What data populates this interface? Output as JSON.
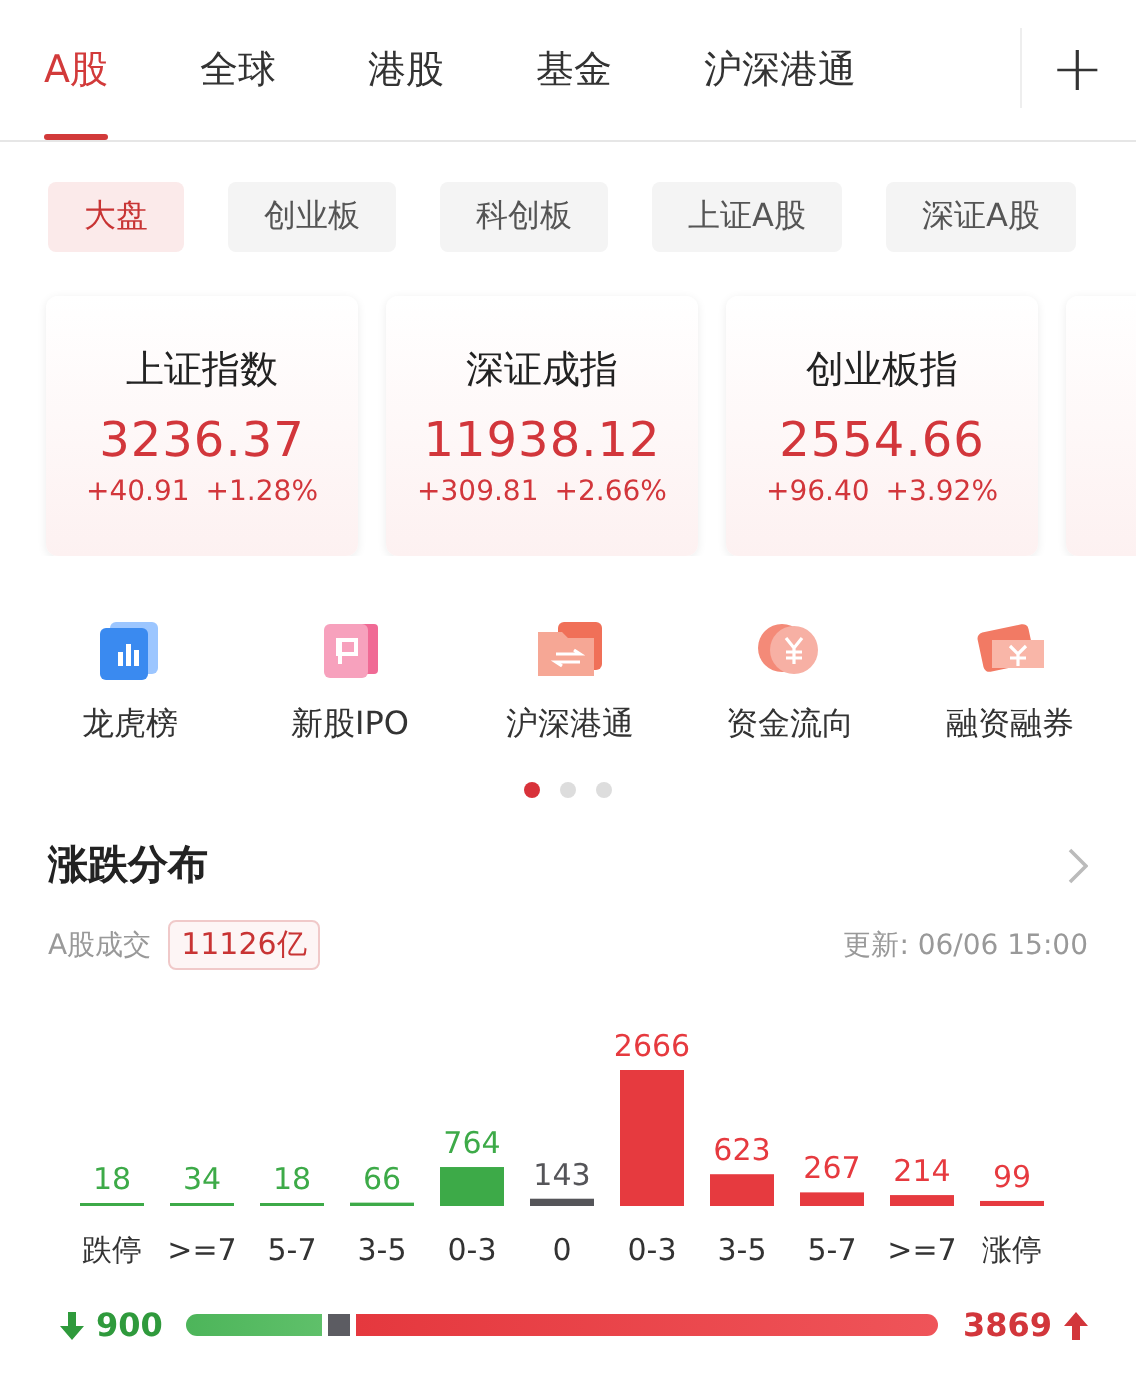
{
  "tabs": [
    {
      "label": "A股",
      "selected": true
    },
    {
      "label": "全球",
      "selected": false
    },
    {
      "label": "港股",
      "selected": false
    },
    {
      "label": "基金",
      "selected": false
    },
    {
      "label": "沪深港通",
      "selected": false
    }
  ],
  "add_button": "+",
  "chips": [
    {
      "label": "大盘",
      "selected": true
    },
    {
      "label": "创业板",
      "selected": false
    },
    {
      "label": "科创板",
      "selected": false
    },
    {
      "label": "上证A股",
      "selected": false
    },
    {
      "label": "深证A股",
      "selected": false
    }
  ],
  "indices": [
    {
      "name": "上证指数",
      "value": "3236.37",
      "change": "+40.91",
      "percent": "+1.28%"
    },
    {
      "name": "深证成指",
      "value": "11938.12",
      "change": "+309.81",
      "percent": "+2.66%"
    },
    {
      "name": "创业板指",
      "value": "2554.66",
      "change": "+96.40",
      "percent": "+3.92%"
    }
  ],
  "shortcuts": [
    {
      "label": "龙虎榜",
      "kind": "chart"
    },
    {
      "label": "新股IPO",
      "kind": "card"
    },
    {
      "label": "沪深港通",
      "kind": "folder"
    },
    {
      "label": "资金流向",
      "kind": "coin"
    },
    {
      "label": "融资融券",
      "kind": "ticket"
    }
  ],
  "pager": [
    {
      "selected": true
    },
    {
      "selected": false
    },
    {
      "selected": false
    }
  ],
  "distribution": {
    "title": "涨跌分布",
    "turnover_label": "A股成交",
    "turnover": "11126亿",
    "updated": "更新: 06/06 15:00",
    "chart_data": {
      "type": "bar",
      "categories": [
        "跌停",
        ">=7",
        "5-7",
        "3-5",
        "0-3",
        "0",
        "0-3",
        "3-5",
        "5-7",
        ">=7",
        "涨停"
      ],
      "stacked": true,
      "data_labels": true,
      "series": [
        {
          "color": "#3daa48",
          "values": [
            18,
            34,
            18,
            66,
            764,
            null,
            null,
            null,
            null,
            null,
            null
          ]
        },
        {
          "color": "#555559",
          "values": [
            null,
            null,
            null,
            null,
            null,
            143,
            null,
            null,
            null,
            null,
            null
          ]
        },
        {
          "color": "#e63a3f",
          "values": [
            null,
            null,
            null,
            null,
            null,
            null,
            2666,
            623,
            267,
            214,
            99
          ]
        }
      ]
    },
    "down_count": "900",
    "up_count": "3869"
  }
}
